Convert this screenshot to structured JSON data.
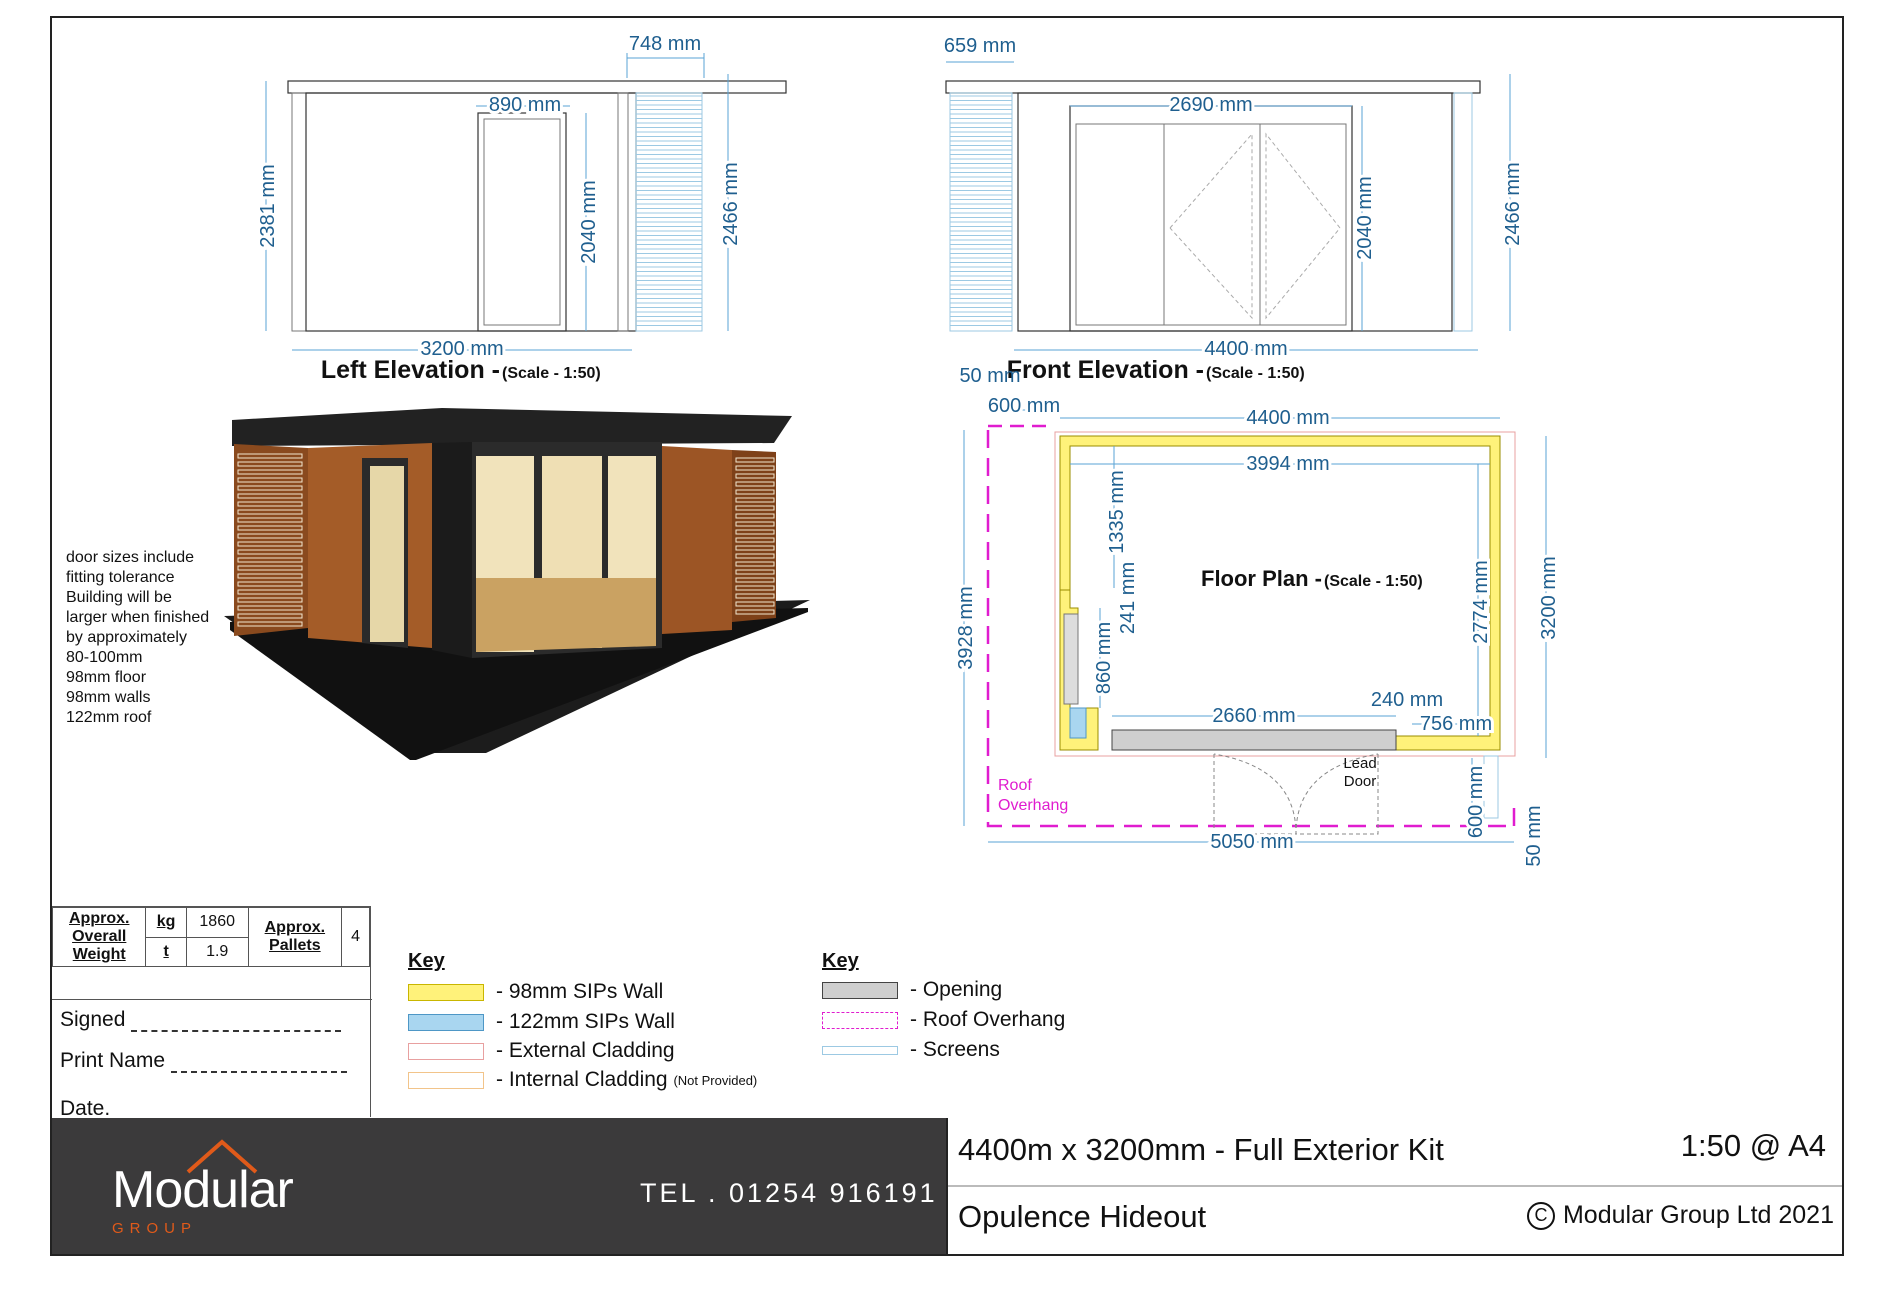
{
  "left_elevation": {
    "title": "Left Elevation - ",
    "scale": "(Scale - 1:50)",
    "dims": {
      "overhang": "748 mm",
      "door_width": "890 mm",
      "height_left": "2381 mm",
      "door_height": "2040 mm",
      "height_right": "2466 mm",
      "width": "3200 mm"
    }
  },
  "front_elevation": {
    "title": "Front Elevation - ",
    "scale": "(Scale - 1:50)",
    "dims": {
      "overhang": "659 mm",
      "door_width": "2690 mm",
      "door_height": "2040 mm",
      "height_right": "2466 mm",
      "width": "4400 mm"
    }
  },
  "floor_plan": {
    "title": "Floor Plan - ",
    "scale": "(Scale - 1:50)",
    "dims": {
      "overhang_top": "50 mm",
      "overhang_600": "600 mm",
      "width_outer": "4400 mm",
      "width_inner": "3994 mm",
      "wall_1335": "1335 mm",
      "wall_241": "241 mm",
      "window_860": "860 mm",
      "depth_3928": "3928 mm",
      "inner_2774": "2774 mm",
      "depth_3200": "3200 mm",
      "door_2660": "2660 mm",
      "seg_240": "240 mm",
      "seg_756": "756 mm",
      "screen_600": "600 mm",
      "bottom_50": "50 mm",
      "total_5050": "5050 mm"
    },
    "labels": {
      "roof_overhang_1": "Roof",
      "roof_overhang_2": "Overhang",
      "lead_door_1": "Lead",
      "lead_door_2": "Door"
    }
  },
  "notes": [
    "door sizes include",
    "fitting tolerance",
    "",
    "Building will be",
    "larger when finished",
    "by approximately",
    "80-100mm",
    "",
    "98mm floor",
    "98mm walls",
    "122mm roof"
  ],
  "weight_table": {
    "label_1": "Approx.",
    "label_2": "Overall",
    "label_3": "Weight",
    "kg_label": "kg",
    "kg_value": "1860",
    "t_label": "t",
    "t_value": "1.9",
    "pallets_1": "Approx.",
    "pallets_2": "Pallets",
    "pallets_value": "4"
  },
  "signature": {
    "signed": "Signed",
    "print_name": "Print Name",
    "date": "Date."
  },
  "key_left": {
    "title": "Key",
    "items": [
      {
        "label": "- 98mm SIPs Wall",
        "color": "#fff27a",
        "border": "#c9b600"
      },
      {
        "label": "- 122mm SIPs Wall",
        "color": "#a9d6f0",
        "border": "#4e97c6"
      },
      {
        "label": "- External Cladding",
        "color": "#ffffff",
        "border": "#e8a0a0"
      },
      {
        "label": "- Internal Cladding",
        "note": "(Not Provided)",
        "color": "#ffffff",
        "border": "#f2c48a"
      }
    ]
  },
  "key_right": {
    "title": "Key",
    "items": [
      {
        "label": "- Opening",
        "color": "#cfcfcf",
        "border": "#444444"
      },
      {
        "label": "- Roof Overhang",
        "color": "#ffffff",
        "border": "#e01ccf"
      },
      {
        "label": "- Screens",
        "color": "#ffffff",
        "border": "#9cc9e3"
      }
    ]
  },
  "footer": {
    "logo_word": "Modular",
    "logo_sub": "GROUP",
    "tel": "TEL . 01254 916191",
    "kit_title": "4400m x 3200mm - Full Exterior Kit",
    "scale": "1:50 @ A4",
    "model": "Opulence Hideout",
    "copyright_symbol": "C",
    "copyright": "Modular Group Ltd 2021"
  }
}
